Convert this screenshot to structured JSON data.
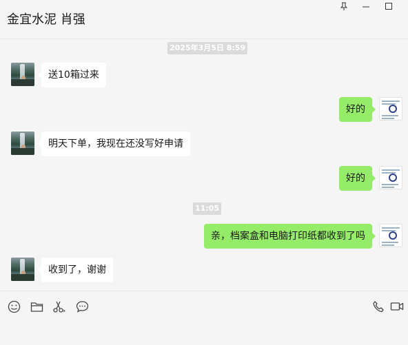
{
  "window": {
    "title": "金宜水泥 肖强"
  },
  "chat": {
    "timestamps": [
      "2025年3月5日 8:59",
      "11:05"
    ],
    "messages": [
      {
        "side": "left",
        "text": "送10箱过来"
      },
      {
        "side": "right",
        "text": "好的"
      },
      {
        "side": "left",
        "text": "明天下单，我现在还没写好申请"
      },
      {
        "side": "right",
        "text": "好的"
      },
      {
        "side": "right",
        "text": "亲，档案盒和电脑打印纸都收到了吗"
      },
      {
        "side": "left",
        "text": "收到了，谢谢"
      }
    ]
  },
  "colors": {
    "background": "#f5f5f5",
    "bubble_right": "#95ec69",
    "bubble_left": "#ffffff",
    "timestamp_bg": "#dadada"
  },
  "icons": {
    "window": [
      "pin-icon",
      "minimize-icon",
      "maximize-icon"
    ],
    "toolbar_left": [
      "emoji-icon",
      "folder-icon",
      "scissors-icon",
      "chat-bubble-icon"
    ],
    "toolbar_right": [
      "phone-icon",
      "video-call-icon"
    ]
  }
}
